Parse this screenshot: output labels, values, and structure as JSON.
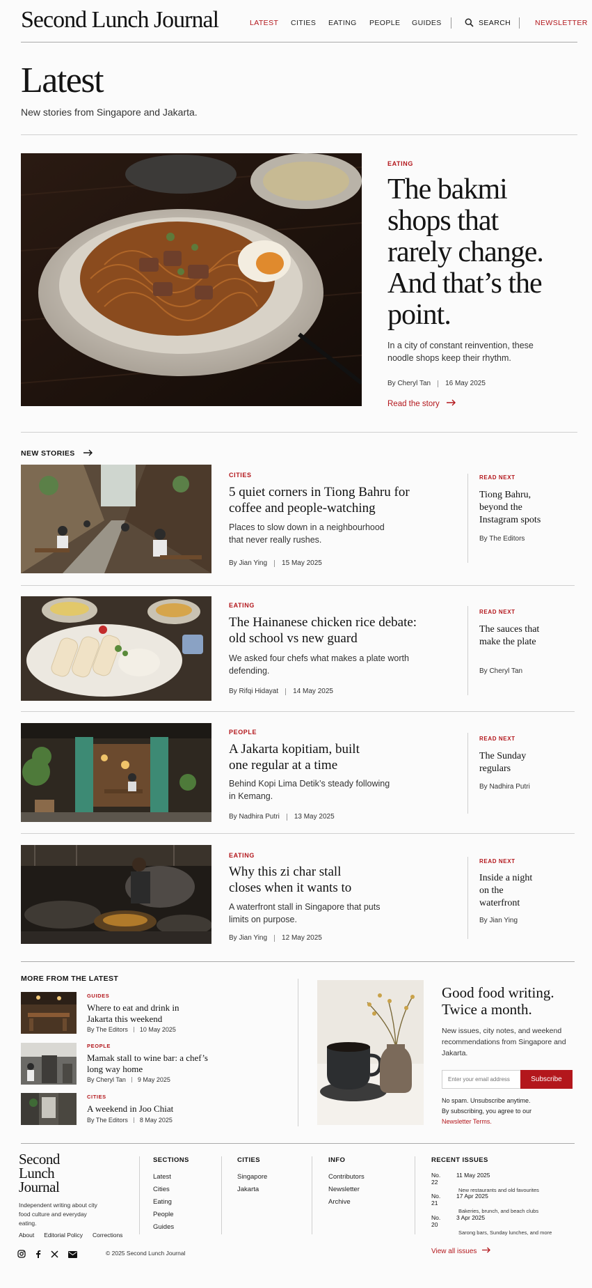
{
  "header": {
    "logo": "Second Lunch Journal",
    "nav": [
      "LATEST",
      "CITIES",
      "EATING",
      "PEOPLE",
      "GUIDES"
    ],
    "search": "SEARCH",
    "newsletter": "NEWSLETTER"
  },
  "page": {
    "title": "Latest",
    "subtitle": "New stories from Singapore and Jakarta."
  },
  "hero": {
    "kicker": "EATING",
    "title": "The bakmi shops that rarely change. And that’s the point.",
    "dek": "In a city of constant reinvention, these noodle shops keep their rhythm.",
    "author": "By Cheryl Tan",
    "date": "16 May 2025",
    "cta": "Read the story"
  },
  "new_stories": {
    "heading": "NEW STORIES",
    "items": [
      {
        "kicker": "CITIES",
        "title": "5 quiet corners in Tiong Bahru for coffee and people-watching",
        "dek": "Places to slow down in a neighbourhood that never really rushes.",
        "author": "By Jian Ying",
        "date": "15 May 2025",
        "rn_label": "READ NEXT",
        "rn_title": "Tiong Bahru, beyond the Instagram spots",
        "rn_author": "By The Editors"
      },
      {
        "kicker": "EATING",
        "title": "The Hainanese chicken rice debate: old school vs new guard",
        "dek": "We asked four chefs what makes a plate worth defending.",
        "author": "By Rifqi Hidayat",
        "date": "14 May 2025",
        "rn_label": "READ NEXT",
        "rn_title": "The sauces that make the plate",
        "rn_author": "By Cheryl Tan"
      },
      {
        "kicker": "PEOPLE",
        "title": "A Jakarta kopitiam, built one regular at a time",
        "dek": "Behind Kopi Lima Detik’s steady following in Kemang.",
        "author": "By Nadhira Putri",
        "date": "13 May 2025",
        "rn_label": "READ NEXT",
        "rn_title": "The Sunday regulars",
        "rn_author": "By Nadhira Putri"
      },
      {
        "kicker": "EATING",
        "title": "Why this zi char stall closes when it wants to",
        "dek": "A waterfront stall in Singapore that puts limits on purpose.",
        "author": "By Jian Ying",
        "date": "12 May 2025",
        "rn_label": "READ NEXT",
        "rn_title": "Inside a night on the waterfront",
        "rn_author": "By Jian Ying"
      }
    ]
  },
  "more": {
    "heading": "MORE FROM THE LATEST",
    "items": [
      {
        "kicker": "GUIDES",
        "title": "Where to eat and drink in Jakarta this weekend",
        "author": "By The Editors",
        "date": "10 May 2025"
      },
      {
        "kicker": "PEOPLE",
        "title": "Mamak stall to wine bar: a chef’s long way home",
        "author": "By Cheryl Tan",
        "date": "9 May 2025"
      },
      {
        "kicker": "CITIES",
        "title": "A weekend in Joo Chiat",
        "author": "By The Editors",
        "date": "8 May 2025"
      }
    ]
  },
  "newsletter": {
    "title": "Good food writing. Twice a month.",
    "body": "New issues, city notes, and weekend recommendations from Singapore and Jakarta.",
    "placeholder": "Enter your email address",
    "button": "Subscribe",
    "fine1": "No spam. Unsubscribe anytime.",
    "fine2": "By subscribing, you agree to our",
    "terms": "Newsletter Terms."
  },
  "footer": {
    "logo": "Second Lunch Journal",
    "tagline": "Independent writing about city food culture and everyday eating.",
    "links": [
      "About",
      "Editorial Policy",
      "Corrections"
    ],
    "copyright": "© 2025 Second Lunch Journal",
    "sections": {
      "heading": "SECTIONS",
      "items": [
        "Latest",
        "Cities",
        "Eating",
        "People",
        "Guides"
      ]
    },
    "cities": {
      "heading": "CITIES",
      "items": [
        "Singapore",
        "Jakarta"
      ]
    },
    "info": {
      "heading": "INFO",
      "items": [
        "Contributors",
        "Newsletter",
        "Archive"
      ]
    },
    "issues": {
      "heading": "RECENT ISSUES",
      "items": [
        {
          "no": "No. 22",
          "date": "11 May 2025",
          "desc": "New restaurants and old favourites"
        },
        {
          "no": "No. 21",
          "date": "17 Apr 2025",
          "desc": "Bakeries, brunch, and beach clubs"
        },
        {
          "no": "No. 20",
          "date": "3 Apr 2025",
          "desc": "Sarong bars, Sunday lunches, and more"
        }
      ],
      "cta": "View all issues"
    }
  },
  "colors": {
    "accent": "#b3171c",
    "ink": "#141414",
    "rule": "#cfcfcf"
  }
}
